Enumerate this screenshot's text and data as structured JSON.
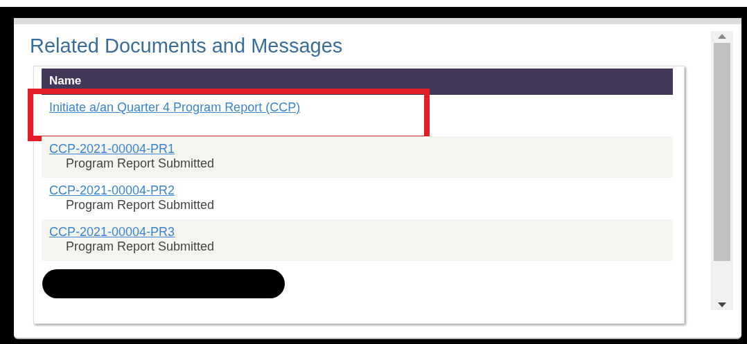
{
  "panel": {
    "title": "Related Documents and Messages"
  },
  "table": {
    "columns": [
      "Name"
    ],
    "rows": [
      {
        "kind": "link",
        "link": "Initiate a/an Quarter 4 Program Report (CCP)",
        "annotated": true
      },
      {
        "kind": "link",
        "link": "CCP-2021-00004-PR1",
        "status": "Program Report Submitted",
        "annotated": false
      },
      {
        "kind": "link",
        "link": "CCP-2021-00004-PR2",
        "status": "Program Report Submitted",
        "annotated": false
      },
      {
        "kind": "link",
        "link": "CCP-2021-00004-PR3",
        "status": "Program Report Submitted",
        "annotated": false
      },
      {
        "kind": "redacted",
        "annotated": false
      }
    ]
  }
}
